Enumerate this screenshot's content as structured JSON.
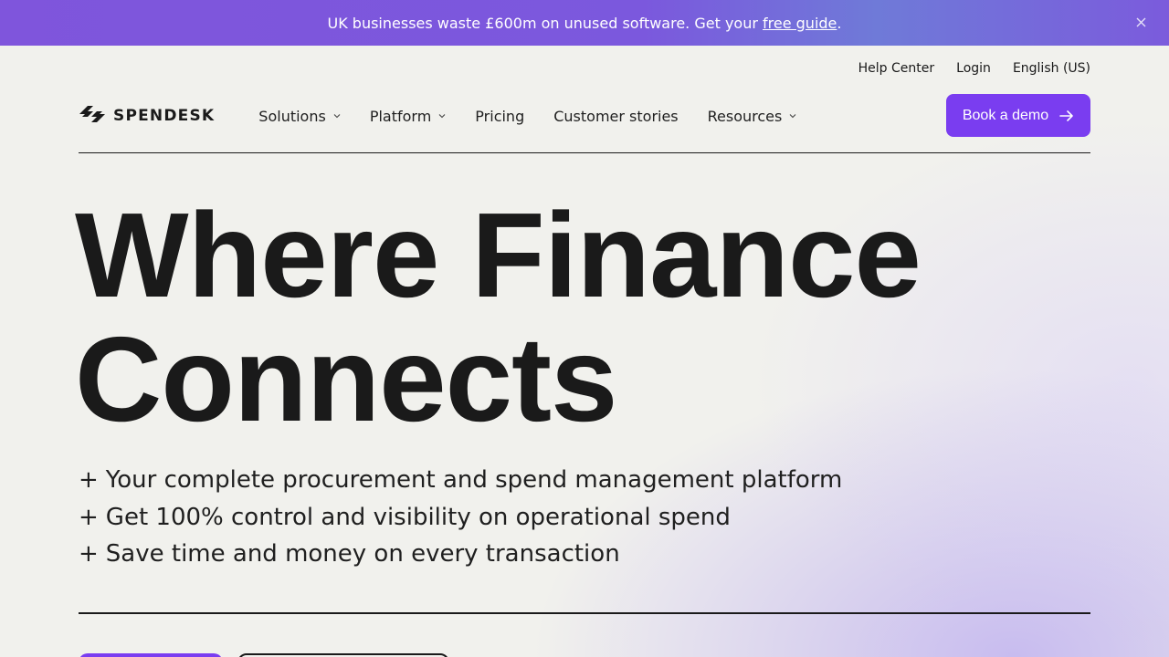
{
  "banner": {
    "text_before": "UK businesses waste £600m on unused software. Get your ",
    "link_text": "free guide",
    "text_after": ".",
    "close_icon": "close-icon",
    "bg_color": "#7f55dc"
  },
  "utility_nav": {
    "help_center": "Help Center",
    "login": "Login",
    "language": "English (US)"
  },
  "logo": {
    "text": "SPENDESK",
    "icon": "spendesk-logo-icon"
  },
  "nav": {
    "items": [
      {
        "label": "Solutions",
        "has_dropdown": true
      },
      {
        "label": "Platform",
        "has_dropdown": true
      },
      {
        "label": "Pricing",
        "has_dropdown": false
      },
      {
        "label": "Customer stories",
        "has_dropdown": false
      },
      {
        "label": "Resources",
        "has_dropdown": true
      }
    ],
    "demo_button": "Book a demo",
    "demo_icon": "arrow-right-icon",
    "accent_color": "#7a3df0"
  },
  "hero": {
    "title_line1": "Where Finance",
    "title_line2": "Connects",
    "bullets": [
      "Your complete procurement and spend management platform",
      "Get 100% control and visibility on operational spend",
      "Save time and money on every transaction"
    ],
    "bullet_marker": "+"
  }
}
